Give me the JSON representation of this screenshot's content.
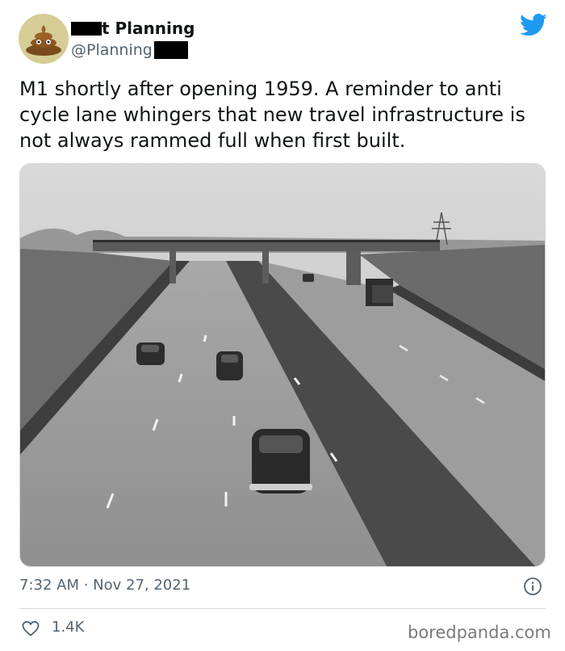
{
  "account": {
    "display_name": "t Planning",
    "handle": "@Planning"
  },
  "tweet": {
    "text": "M1 shortly after opening 1959. A reminder to anti cycle lane whingers that new travel infrastructure is not always rammed full when first built.",
    "timestamp": "7:32 AM · Nov 27, 2021",
    "likes": "1.4K"
  },
  "watermark": "boredpanda.com",
  "icons": {
    "brand": "twitter-bird-icon",
    "info": "info-icon",
    "like": "heart-icon",
    "avatar": "poop-emoji-icon"
  },
  "colors": {
    "twitter_blue": "#1d9bf0",
    "secondary_text": "#536471",
    "border": "#cfd9de"
  }
}
